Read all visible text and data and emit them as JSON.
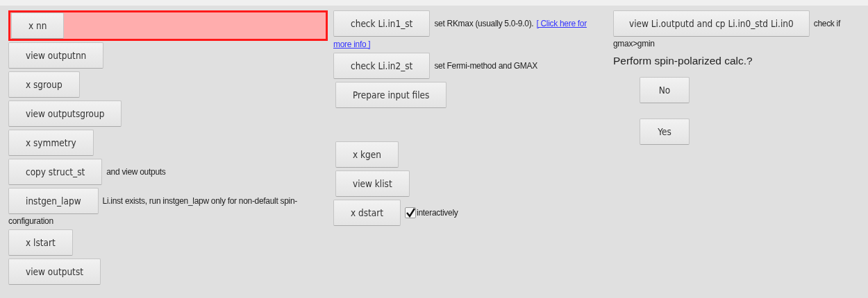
{
  "left_rows": [
    {
      "button": "x nn",
      "highlighted": true
    },
    {
      "button": "view outputnn",
      "highlighted": false
    },
    {
      "button": "x sgroup",
      "highlighted": false
    },
    {
      "button": "view outputsgroup",
      "highlighted": false
    },
    {
      "button": "x symmetry",
      "highlighted": false
    },
    {
      "button": "copy struct_st",
      "note": "and view outputs",
      "highlighted": false
    },
    {
      "button": "instgen_lapw",
      "note": "Li.inst exists, run instgen_lapw only for non-default spin-",
      "note_cont": "configuration",
      "highlighted": false
    },
    {
      "button": "x lstart",
      "highlighted": false
    },
    {
      "button": "view outputst",
      "highlighted": false
    }
  ],
  "middle_rows": [
    {
      "kind": "button",
      "button": "check Li.in1_st",
      "note": "set RKmax (usually 5.0-9.0).",
      "link": "[ Click here for",
      "link_cont": "more info ]"
    },
    {
      "kind": "button",
      "button": "check Li.in2_st",
      "note": "set Fermi-method and GMAX"
    },
    {
      "kind": "button",
      "button": "Prepare input files"
    },
    {
      "kind": "spacer"
    },
    {
      "kind": "button",
      "button": "x kgen"
    },
    {
      "kind": "button",
      "button": "view klist"
    },
    {
      "kind": "checkbox",
      "button": "x dstart",
      "label": "interactively",
      "checked": true
    }
  ],
  "right": {
    "button": "view Li.outputd and cp Li.in0_std Li.in0",
    "note": "check if",
    "note_cont": "gmax>gmin",
    "question": "Perform spin-polarized calc.?",
    "answers": [
      "No",
      "Yes"
    ]
  }
}
